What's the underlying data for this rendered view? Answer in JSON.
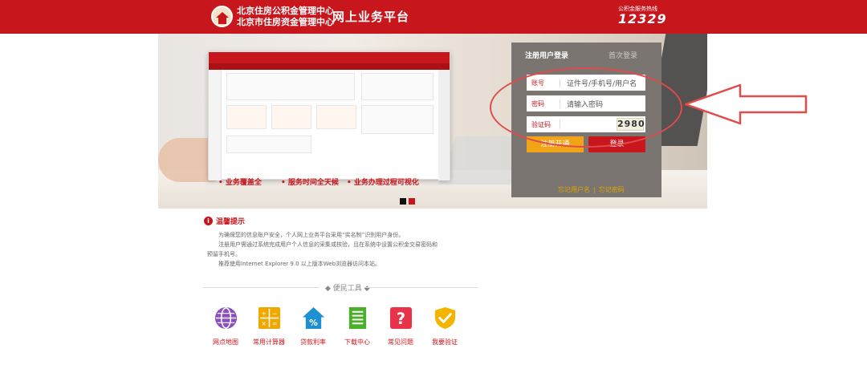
{
  "header": {
    "org_line1": "北京住房公积金管理中心",
    "org_line2": "北京市住房资金管理中心",
    "platform_title": "网上业务平台",
    "hotline_label": "公积金服务热线",
    "hotline_number": "12329",
    "brand_color": "#c8161d"
  },
  "banner": {
    "slogans": [
      "• 业务覆盖全",
      "• 服务时间全天候",
      "• 业务办理过程可视化"
    ],
    "active_dot_color": "#111111",
    "dot_color": "#c8161d"
  },
  "login": {
    "tab_registered": "注册用户登录",
    "tab_first_time": "首次登录",
    "account_label": "账号",
    "account_placeholder": "证件号/手机号/用户名",
    "password_label": "密码",
    "password_placeholder": "请输入密码",
    "captcha_label": "验证码",
    "captcha_value": "2980",
    "register_button": "注册开通",
    "login_button": "登录",
    "forgot_username": "忘记用户名",
    "forgot_password": "忘记密码",
    "link_separator": "|"
  },
  "notice": {
    "title": "温馨提示",
    "icon": "info-icon",
    "lines": [
      "为确保您的信息账户安全，个人网上业务平台采用“实名制”识别用户身份。",
      "注册用户需通过系统完成用户个人信息的采集或核验，且在系统中设置公积金交易密码和",
      "预留手机号。",
      "推荐使用Internet Explorer 9.0 以上版本Web浏览器访问本站。"
    ]
  },
  "tools": {
    "title": "◆ 便民工具 ◆",
    "items": [
      {
        "label": "网点地图",
        "icon": "globe-icon",
        "color": "#8a4fc0"
      },
      {
        "label": "常用计算器",
        "icon": "calculator-icon",
        "color": "#f0a800"
      },
      {
        "label": "贷款利率",
        "icon": "rate-house-icon",
        "color": "#1e8fd0"
      },
      {
        "label": "下载中心",
        "icon": "download-document-icon",
        "color": "#4caf2c"
      },
      {
        "label": "常见问题",
        "icon": "question-icon",
        "color": "#e8334a"
      },
      {
        "label": "我要验证",
        "icon": "shield-check-icon",
        "color": "#f5b400"
      }
    ]
  }
}
